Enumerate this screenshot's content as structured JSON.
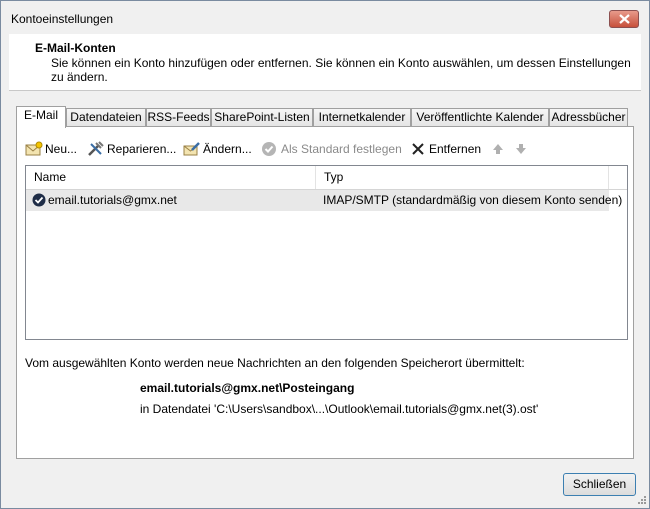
{
  "window": {
    "title": "Kontoeinstellungen"
  },
  "header": {
    "title": "E-Mail-Konten",
    "description": "Sie können ein Konto hinzufügen oder entfernen. Sie können ein Konto auswählen, um dessen Einstellungen zu ändern."
  },
  "tabs": [
    {
      "label": "E-Mail",
      "active": true
    },
    {
      "label": "Datendateien"
    },
    {
      "label": "RSS-Feeds"
    },
    {
      "label": "SharePoint-Listen"
    },
    {
      "label": "Internetkalender"
    },
    {
      "label": "Veröffentlichte Kalender"
    },
    {
      "label": "Adressbücher"
    }
  ],
  "toolbar": {
    "new_label": "Neu...",
    "repair_label": "Reparieren...",
    "change_label": "Ändern...",
    "set_default_label": "Als Standard festlegen",
    "remove_label": "Entfernen"
  },
  "accounts": {
    "columns": [
      "Name",
      "Typ"
    ],
    "rows": [
      {
        "name": "email.tutorials@gmx.net",
        "type": "IMAP/SMTP (standardmäßig von diesem Konto senden)"
      }
    ]
  },
  "delivery": {
    "text": "Vom ausgewählten Konto werden neue Nachrichten an den folgenden Speicherort übermittelt:",
    "folder": "email.tutorials@gmx.net\\Posteingang",
    "file": "in Datendatei 'C:\\Users\\sandbox\\...\\Outlook\\email.tutorials@gmx.net(3).ost'"
  },
  "footer": {
    "close_label": "Schließen"
  }
}
